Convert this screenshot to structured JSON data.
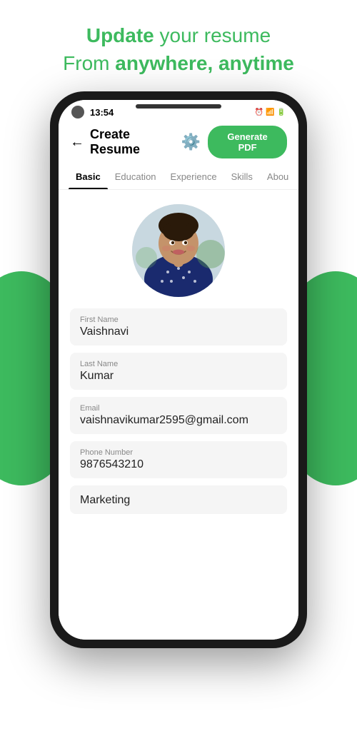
{
  "header": {
    "line1_prefix": "Update",
    "line1_suffix": " your resume",
    "line2_prefix": "From ",
    "line2_strong": "anywhere, anytime"
  },
  "status_bar": {
    "time": "13:54",
    "icons": "⏰ 📶 🔋"
  },
  "app_bar": {
    "title": "Create Resume",
    "generate_label": "Generate PDF"
  },
  "tabs": [
    {
      "id": "basic",
      "label": "Basic",
      "active": true
    },
    {
      "id": "education",
      "label": "Education",
      "active": false
    },
    {
      "id": "experience",
      "label": "Experience",
      "active": false
    },
    {
      "id": "skills",
      "label": "Skills",
      "active": false
    },
    {
      "id": "about",
      "label": "Abou",
      "active": false
    }
  ],
  "form": {
    "first_name_label": "First Name",
    "first_name_value": "Vaishnavi",
    "last_name_label": "Last Name",
    "last_name_value": "Kumar",
    "email_label": "Email",
    "email_value": "vaishnavikumar2595@gmail.com",
    "phone_label": "Phone Number",
    "phone_value": "9876543210",
    "category_label": "",
    "category_value": "Marketing"
  }
}
